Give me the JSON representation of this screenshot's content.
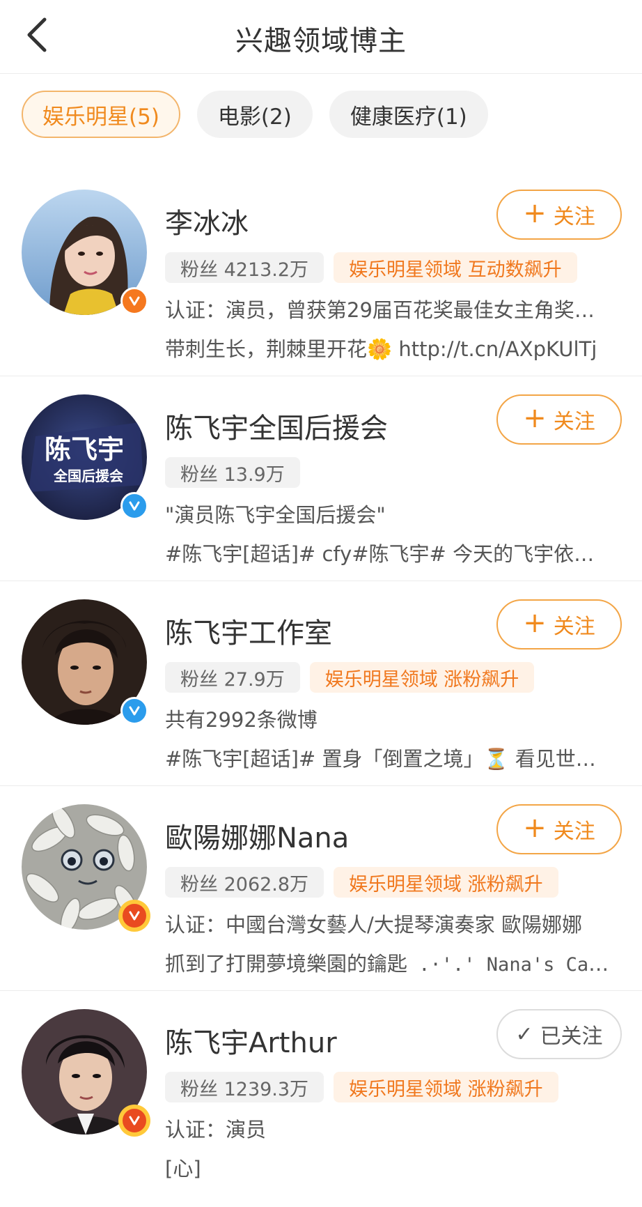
{
  "header": {
    "title": "兴趣领域博主",
    "back_icon": "chevron-left-icon"
  },
  "tabs": [
    {
      "label": "娱乐明星(5)",
      "active": true
    },
    {
      "label": "电影(2)",
      "active": false
    },
    {
      "label": "健康医疗(1)",
      "active": false
    }
  ],
  "items": [
    {
      "name": "李冰冰",
      "fans": "粉丝 4213.2万",
      "domain_tag": "娱乐明星领域 互动数飙升",
      "line1": "认证：演员，曾获第29届百花奖最佳女主角奖…",
      "line2_text": "带刺生长，荆棘里开花",
      "line2_emoji": "🌼",
      "line2_link": " http://t.cn/AXpKUlTj",
      "follow_label": "关注",
      "follow_icon": "+",
      "verified": "orange"
    },
    {
      "name": "陈飞宇全国后援会",
      "fans": "粉丝 13.9万",
      "line1": "\"演员陈飞宇全国后援会\"",
      "line2": "#陈飞宇[超话]# cfy#陈飞宇# 今天的飞宇依旧…",
      "follow_label": "关注",
      "follow_icon": "+",
      "verified": "blue",
      "avatar_text1": "陈飞宇",
      "avatar_text2": "全国后援会"
    },
    {
      "name": "陈飞宇工作室",
      "fans": "粉丝 27.9万",
      "domain_tag": "娱乐明星领域 涨粉飙升",
      "line1": "共有2992条微博",
      "line2": "#陈飞宇[超话]# 置身「倒置之境」⏳ 看见世界…",
      "follow_label": "关注",
      "follow_icon": "+",
      "verified": "blue"
    },
    {
      "name": "歐陽娜娜Nana",
      "fans": "粉丝 2062.8万",
      "domain_tag": "娱乐明星领域 涨粉飙升",
      "line1": "认证：中國台灣女藝人/大提琴演奏家 歐陽娜娜",
      "line2_text": "抓到了打開夢境樂園的鑰匙",
      "line2_mono": " .·'.' Nana's Carni…",
      "follow_label": "关注",
      "follow_icon": "+",
      "verified": "red"
    },
    {
      "name": "陈飞宇Arthur",
      "fans": "粉丝 1239.3万",
      "domain_tag": "娱乐明星领域 涨粉飙升",
      "line1": "认证：演员",
      "line2": "[心]",
      "follow_label": "已关注",
      "follow_icon": "✓",
      "verified": "red"
    }
  ],
  "colors": {
    "accent": "#f08a1e",
    "tag_bg": "#fff2e6",
    "fans_bg": "#f2f2f2"
  }
}
